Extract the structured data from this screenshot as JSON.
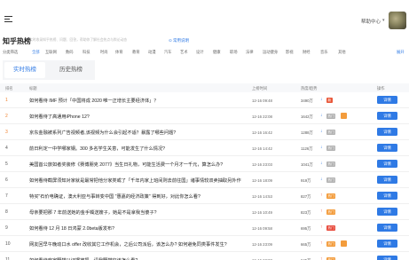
{
  "header": {
    "help": "帮助中心",
    "caret": "▾"
  },
  "title": {
    "main": "知乎热榜",
    "subtitle": "实时收录知乎热榜、问题、回答，帮助你了解社会热点与舆论动态",
    "link": "⊙ 常用说明"
  },
  "categories": [
    {
      "label": "分类筛选",
      "active": false
    },
    {
      "label": "全部",
      "active": true
    },
    {
      "label": "互联网",
      "active": false
    },
    {
      "label": "数码",
      "active": false
    },
    {
      "label": "科技",
      "active": false
    },
    {
      "label": "时尚",
      "active": false
    },
    {
      "label": "体育",
      "active": false
    },
    {
      "label": "教育",
      "active": false
    },
    {
      "label": "动漫",
      "active": false
    },
    {
      "label": "汽车",
      "active": false
    },
    {
      "label": "艺术",
      "active": false
    },
    {
      "label": "设计",
      "active": false
    },
    {
      "label": "健康",
      "active": false
    },
    {
      "label": "职场",
      "active": false
    },
    {
      "label": "法律",
      "active": false
    },
    {
      "label": "运动健身",
      "active": false
    },
    {
      "label": "影视",
      "active": false
    },
    {
      "label": "财经",
      "active": false
    },
    {
      "label": "音乐",
      "active": false
    },
    {
      "label": "其他",
      "active": false
    },
    {
      "label": "展开",
      "active": true
    }
  ],
  "tabs": {
    "live": "实时热榜",
    "history": "历史热榜"
  },
  "table": {
    "headers": {
      "rank": "排名",
      "title": "标题",
      "time": "上榜时间",
      "heat": "热度/趋势",
      "action": "操作"
    },
    "rows": [
      {
        "rank": "1",
        "title": "如何看待 IMF 预计「中国将成 2020 唯一正增长主要经济体」？",
        "time": "12-16 09:48",
        "heat": "3490万",
        "trend": "down",
        "tag": "新",
        "tagtype": "new",
        "badge": false,
        "action": "详情"
      },
      {
        "rank": "2",
        "title": "如何看待了高通用iPhone 12?",
        "time": "12-16 22:08",
        "heat": "1642万",
        "trend": "down",
        "tag": "热门",
        "tagtype": "gray",
        "badge": true,
        "action": "详情"
      },
      {
        "rank": "3",
        "title": "京东金融被系列广告视频者,该视频为什么会引起不适？暴露了哪些问题?",
        "time": "12-16 16:42",
        "heat": "1288万",
        "trend": "down",
        "tag": "热门",
        "tagtype": "gray",
        "badge": false,
        "action": "详情"
      },
      {
        "rank": "4",
        "title": "前日利定一中学哪家钢。300 多名学生关意，可能发生了什么情况?",
        "time": "12-16 14:42",
        "heat": "1126万",
        "trend": "down",
        "tag": "热门",
        "tagtype": "gray",
        "badge": false,
        "action": "详情"
      },
      {
        "rank": "5",
        "title": "美国首公旅如者奖装修《赛博朋克 2077》当生日礼物，可能生活费一个月才一千元，算怎么办?",
        "time": "12-16 23:03",
        "heat": "1041万",
        "trend": "down",
        "tag": "热门",
        "tagtype": "gray",
        "badge": false,
        "action": "详情"
      },
      {
        "rank": "6",
        "title": "如何看待截屏须知对家就是最常把他分家类或了「千年内家上班间则去前往国」诸事情较双卖抽取另外作",
        "time": "12-16 18:09",
        "heat": "919万",
        "trend": "down",
        "tag": "热门",
        "tagtype": "gray",
        "badge": false,
        "action": "详情"
      },
      {
        "rank": "7",
        "title": "特买\"石价电确证，澳大利亚与事转变中国 \"惠嘉的经济政策\" 得到好，对此你怎么看?",
        "time": "12-16 14:53",
        "heat": "827万",
        "trend": "up",
        "tag": "热门",
        "tagtype": "orange",
        "badge": false,
        "action": "详情"
      },
      {
        "rank": "8",
        "title": "母亲要把那 7 年前送她的金手镯送嫂子，她是不是拿我当傻子?",
        "time": "12-16 10:49",
        "heat": "823万",
        "trend": "up",
        "tag": "热门",
        "tagtype": "orange",
        "badge": false,
        "action": "详情"
      },
      {
        "rank": "9",
        "title": "如何看待 12 月 18 日鸿蒙 2.0beta版发布?",
        "time": "12-16 09:58",
        "heat": "695万",
        "trend": "up",
        "tag": "热门",
        "tagtype": "red",
        "badge": false,
        "action": "详情"
      },
      {
        "rank": "10",
        "title": "网友回早午晚动口水 offer 改收其它工作机会，之后公司派后，该怎么办? 如何避免同类事件发生?",
        "time": "12-16 23:09",
        "heat": "665万",
        "trend": "up",
        "tag": "热门",
        "tagtype": "orange",
        "badge": true,
        "action": "详情"
      },
      {
        "rank": "11",
        "title": "如何看待商家野猫以证据被把，请我野猫空该怎么看?",
        "time": "12-16 22:03",
        "heat": "645万",
        "trend": "up",
        "tag": "热门",
        "tagtype": "orange",
        "badge": false,
        "action": "详情"
      }
    ]
  },
  "colors": {
    "accent": "#2f7ae5",
    "hot": "#f0802b",
    "up": "#e84a3c",
    "down": "#2f7ae5"
  }
}
